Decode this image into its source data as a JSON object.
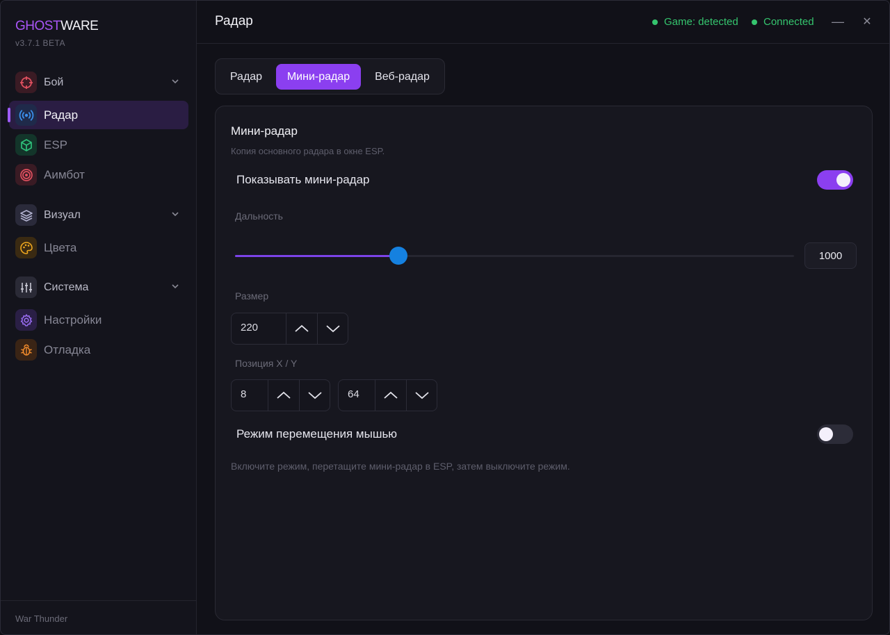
{
  "app": {
    "brand_ghost": "GHOST",
    "brand_ware": "WARE",
    "version": "v3.7.1 BETA",
    "accent_color": "#8b3ff0",
    "status_color": "#35c56e"
  },
  "sidebar": {
    "items": [
      {
        "label": "Бой",
        "icon": "crosshair-icon",
        "kind": "group"
      },
      {
        "label": "Радар",
        "icon": "radar-icon",
        "kind": "sub",
        "active": true
      },
      {
        "label": "ESP",
        "icon": "cube-icon",
        "kind": "sub"
      },
      {
        "label": "Аимбот",
        "icon": "target-icon",
        "kind": "sub"
      },
      {
        "label": "Визуал",
        "icon": "layers-icon",
        "kind": "group"
      },
      {
        "label": "Цвета",
        "icon": "palette-icon",
        "kind": "sub"
      },
      {
        "label": "Система",
        "icon": "sliders-icon",
        "kind": "group"
      },
      {
        "label": "Настройки",
        "icon": "gear-icon",
        "kind": "sub"
      },
      {
        "label": "Отладка",
        "icon": "bug-icon",
        "kind": "sub"
      }
    ],
    "footer": "War Thunder"
  },
  "header": {
    "title": "Радар",
    "status_game": "Game: detected",
    "status_conn": "Connected",
    "minimize_glyph": "—",
    "close_glyph": "✕"
  },
  "tabs": [
    "Радар",
    "Мини-радар",
    "Веб-радар"
  ],
  "active_tab": "Мини-радар",
  "card": {
    "title": "Мини-радар",
    "subtitle": "Копия основного радара в окне ESP.",
    "show_label": "Показывать мини-радар",
    "show_enabled": true,
    "range_label": "Дальность",
    "range_value": "1000",
    "range_fraction": 0.292,
    "size_label": "Размер",
    "size_value": "220",
    "pos_label": "Позиция X / Y",
    "pos_x": "8",
    "pos_y": "64",
    "mouse_label": "Режим перемещения мышью",
    "mouse_enabled": false,
    "hint": "Включите режим, перетащите мини-радар в ESP, затем выключите режим."
  }
}
